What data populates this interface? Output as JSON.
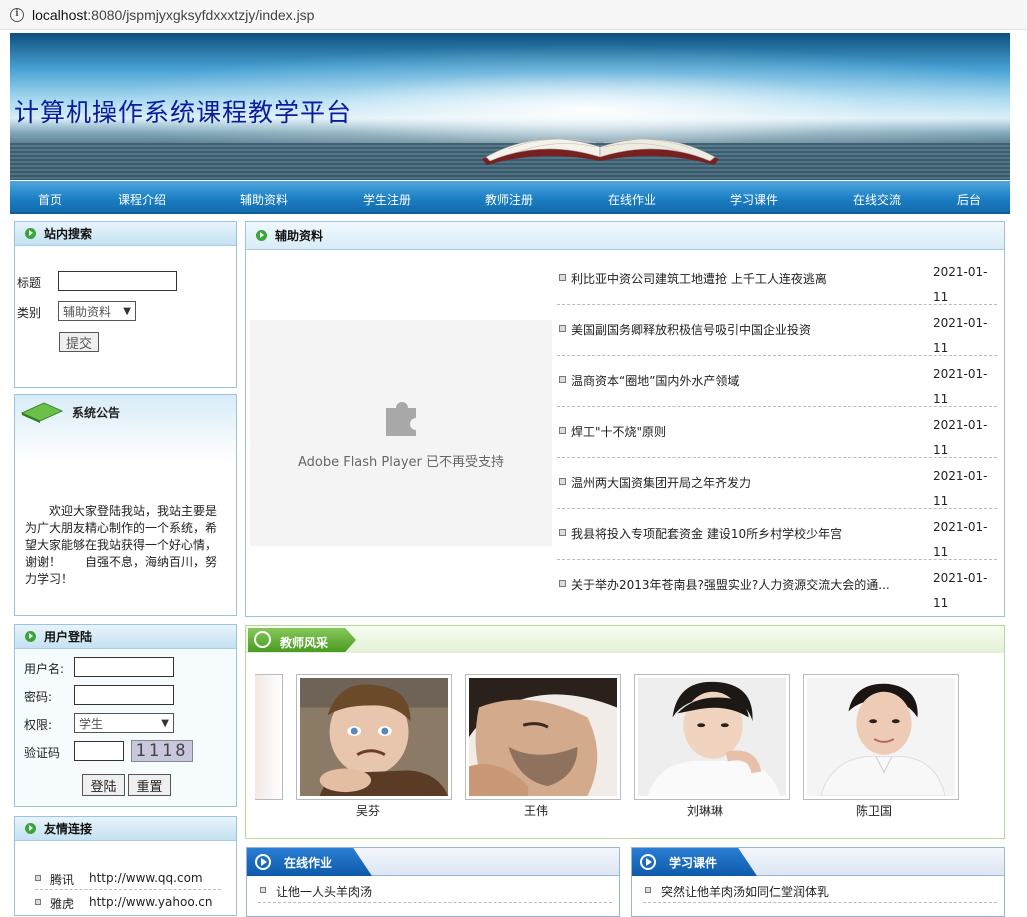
{
  "browser": {
    "url_host": "localhost",
    "url_rest": ":8080/jspmjyxgksyfdxxxtzjy/index.jsp"
  },
  "site": {
    "title": "计算机操作系统课程教学平台"
  },
  "nav": [
    "首页",
    "课程介绍",
    "辅助资料",
    "学生注册",
    "教师注册",
    "在线作业",
    "学习课件",
    "在线交流",
    "后台"
  ],
  "search": {
    "title": "站内搜索",
    "label_title": "标题",
    "label_category": "类别",
    "category_value": "辅助资料",
    "submit": "提交"
  },
  "notice": {
    "title": "系统公告",
    "body": "欢迎大家登陆我站，我站主要是为广大朋友精心制作的一个系统，希望大家能够在我站获得一个好心情，谢谢！　　自强不息，海纳百川，努力学习！"
  },
  "login": {
    "title": "用户登陆",
    "user_label": "用户名:",
    "password_label": "密码:",
    "role_label": "权限:",
    "role_value": "学生",
    "captcha_label": "验证码",
    "captcha_value": "1118",
    "login_button": "登陆",
    "reset_button": "重置"
  },
  "links": {
    "title": "友情连接",
    "items": [
      {
        "name": "腾讯",
        "url": "http://www.qq.com"
      },
      {
        "name": "雅虎",
        "url": "http://www.yahoo.cn"
      }
    ]
  },
  "materials": {
    "title": "辅助资料",
    "flash_message": "Adobe Flash Player 已不再受支持",
    "items": [
      {
        "title": "利比亚中资公司建筑工地遭抢 上千工人连夜逃离",
        "date": "2021-01-11"
      },
      {
        "title": "美国副国务卿释放积极信号吸引中国企业投资",
        "date": "2021-01-11"
      },
      {
        "title": "温商资本“圈地”国内外水产领域",
        "date": "2021-01-11"
      },
      {
        "title": "焊工\"十不烧\"原则",
        "date": "2021-01-11"
      },
      {
        "title": "温州两大国资集团开局之年齐发力",
        "date": "2021-01-11"
      },
      {
        "title": "我县将投入专项配套资金 建设10所乡村学校少年宫",
        "date": "2021-01-11"
      },
      {
        "title": "关于举办2013年苍南县?强盟实业?人力资源交流大会的通...",
        "date": "2021-01-11"
      }
    ]
  },
  "teachers": {
    "title": "教师风采",
    "items": [
      "吴芬",
      "王伟",
      "刘琳琳",
      "陈卫国"
    ]
  },
  "homework": {
    "title": "在线作业",
    "items": [
      "让他一人头羊肉汤"
    ]
  },
  "courseware": {
    "title": "学习课件",
    "items": [
      "突然让他羊肉汤如同仁堂润体乳"
    ]
  },
  "colors": {
    "nav_blue": "#1c7fc4",
    "title_blue": "#0b1d9b",
    "panel_border": "#9cc3df",
    "green_header": "#61b04a"
  }
}
